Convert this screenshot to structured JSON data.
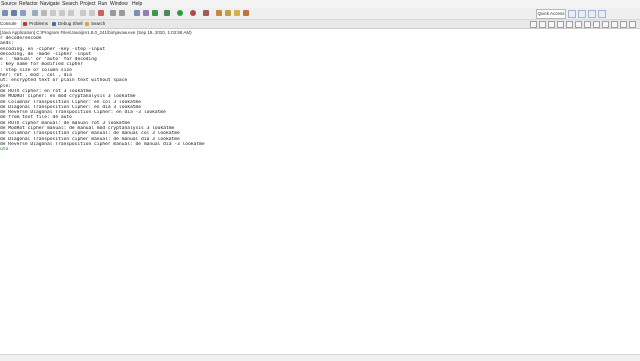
{
  "menu": [
    "Source",
    "Refactor",
    "Navigate",
    "Search",
    "Project",
    "Run",
    "Window",
    "Help"
  ],
  "quick_access": "Quick Access",
  "tabs": [
    {
      "label": "Console",
      "icon": "console-icon",
      "active": true
    },
    {
      "label": "Problems",
      "icon": "problems-icon",
      "active": false
    },
    {
      "label": "Debug Shell",
      "icon": "debug-shell-icon",
      "active": false
    },
    {
      "label": "Search",
      "icon": "search-icon",
      "active": false
    }
  ],
  "run_info": "[Java Application] C:\\Program Files\\Java\\jre1.8.0_241\\bin\\javaw.exe (Sep 18, 2020, 1:03:58 AM)",
  "console_lines": [
    "r decode/encode",
    "ands:",
    "encoding, en -cipher -key -step -input",
    "decoding, de -mode -cipher -input",
    "e : 'manual' or 'auto' for decoding",
    ": key name for modified cipher",
    ": step size or column size",
    "her: rot , mod , col , dia",
    "ut: encrypted text or plain text without space",
    "ple:",
    "de ROTX cipher: en rot 3 lookatme",
    "de MODROT cipher: en mod cryptanalysis 3 lookatme",
    "de Columnar Transposition Cipher: en col 3 lookatme",
    "de Diagonal Transposition Cipher: en dia 3 lookatme",
    "de Reverse Diagonal Transposition Cipher: en dia -3 lookatme",
    "de from text file: de auto",
    "de ROTX cipher manual: de manual rot 3 lookatme",
    "de ModRot cipher manual: de manual mod cryptanalysis 3 lookatme",
    "de Columnar Transposition cipher manual: de manual col 3 lookatme",
    "de Diagonal Transposition cipher manual: de manual dia 3 lookatme",
    "de Reverse Diagonal Transposition cipher manual: de manual dia -3 lookatme"
  ],
  "console_input": "uto"
}
